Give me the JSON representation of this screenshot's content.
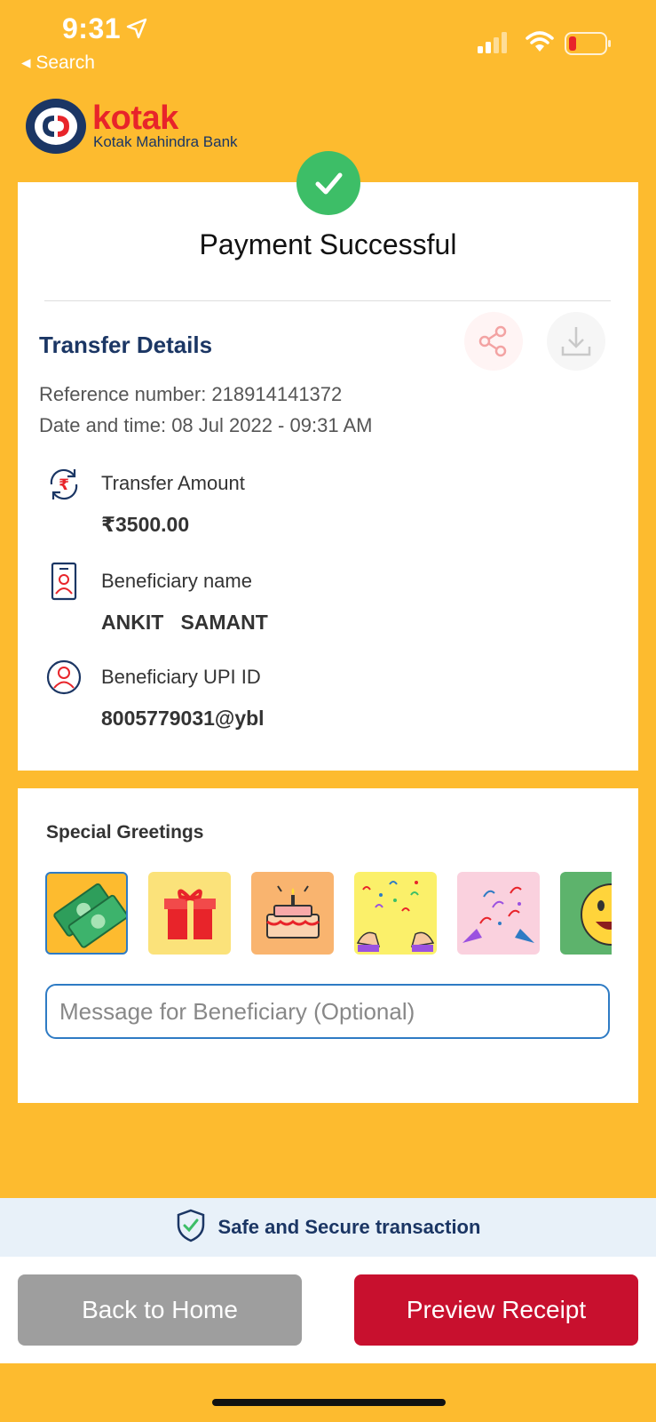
{
  "status_bar": {
    "time": "9:31",
    "back_label": "◂ Search",
    "icons": [
      "location-arrow-icon",
      "signal-icon",
      "wifi-icon",
      "battery-low-icon"
    ]
  },
  "logo": {
    "word": "kotak",
    "subtitle": "Kotak Mahindra Bank"
  },
  "payment": {
    "status_title": "Payment Successful",
    "section_title": "Transfer Details",
    "reference_line": "Reference number: 218914141372",
    "date_line": "Date and time: 08 Jul 2022 - 09:31 AM",
    "details": [
      {
        "label": "Transfer Amount",
        "value": "₹3500.00",
        "icon": "rupee-transfer-icon"
      },
      {
        "label": "Beneficiary name",
        "value": "ANKIT   SAMANT",
        "icon": "id-card-icon"
      },
      {
        "label": "Beneficiary UPI ID",
        "value": "8005779031@ybl",
        "icon": "user-circle-icon"
      }
    ]
  },
  "greetings": {
    "title": "Special Greetings",
    "tiles": [
      {
        "name": "money-greeting",
        "bg": "#FDBB2F",
        "selected": true
      },
      {
        "name": "gift-greeting",
        "bg": "#FBE27A",
        "selected": false
      },
      {
        "name": "cake-greeting",
        "bg": "#F9B46F",
        "selected": false
      },
      {
        "name": "confetti-greeting",
        "bg": "#FBF06A",
        "selected": false
      },
      {
        "name": "party-popper-greeting",
        "bg": "#FAD1DE",
        "selected": false
      },
      {
        "name": "smiley-greeting",
        "bg": "#5DB36C",
        "selected": false
      }
    ],
    "message_placeholder": "Message for Beneficiary (Optional)",
    "message_value": ""
  },
  "footer": {
    "secure_text": "Safe and Secure transaction",
    "back_home_label": "Back to Home",
    "preview_receipt_label": "Preview Receipt"
  },
  "colors": {
    "background": "#FDBB2F",
    "brand_navy": "#1B3664",
    "brand_red": "#E8242A",
    "success_green": "#3DBE67",
    "primary_button": "#C8102E",
    "secondary_button": "#9E9E9E"
  }
}
